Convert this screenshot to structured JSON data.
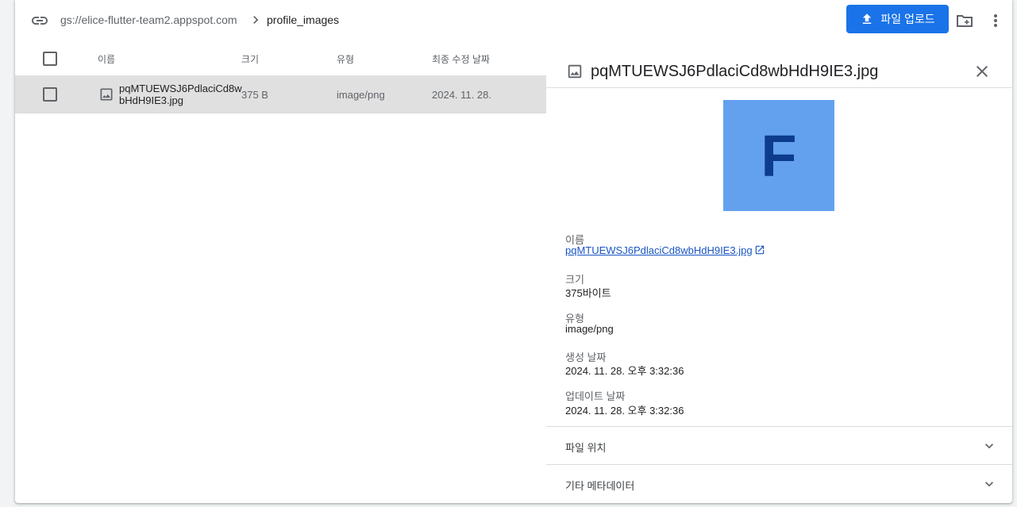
{
  "breadcrumb": {
    "bucket": "gs://elice-flutter-team2.appspot.com",
    "folder": "profile_images"
  },
  "toolbar": {
    "upload_label": "파일 업로드"
  },
  "table": {
    "columns": [
      "이름",
      "크기",
      "유형",
      "최종 수정 날짜"
    ],
    "rows": [
      {
        "name": "pqMTUEWSJ6PdlaciCd8wbHdH9IE3.jpg",
        "size": "375 B",
        "type": "image/png",
        "modified": "2024. 11. 28."
      }
    ]
  },
  "panel": {
    "title": "pqMTUEWSJ6PdlaciCd8wbHdH9IE3.jpg",
    "preview_letter": "F",
    "fields": {
      "name_label": "이름",
      "name_value": "pqMTUEWSJ6PdlaciCd8wbHdH9IE3.jpg",
      "size_label": "크기",
      "size_value": "375바이트",
      "type_label": "유형",
      "type_value": "image/png",
      "created_label": "생성 날짜",
      "created_value": "2024. 11. 28. 오후 3:32:36",
      "updated_label": "업데이트 날짜",
      "updated_value": "2024. 11. 28. 오후 3:32:36"
    },
    "sections": [
      "파일 위치",
      "기타 메타데이터"
    ]
  },
  "colors": {
    "accent": "#1a73e8",
    "selected_row": "#e0e0e0",
    "preview_bg": "#63a1ef",
    "preview_letter": "#0d3c8c"
  }
}
